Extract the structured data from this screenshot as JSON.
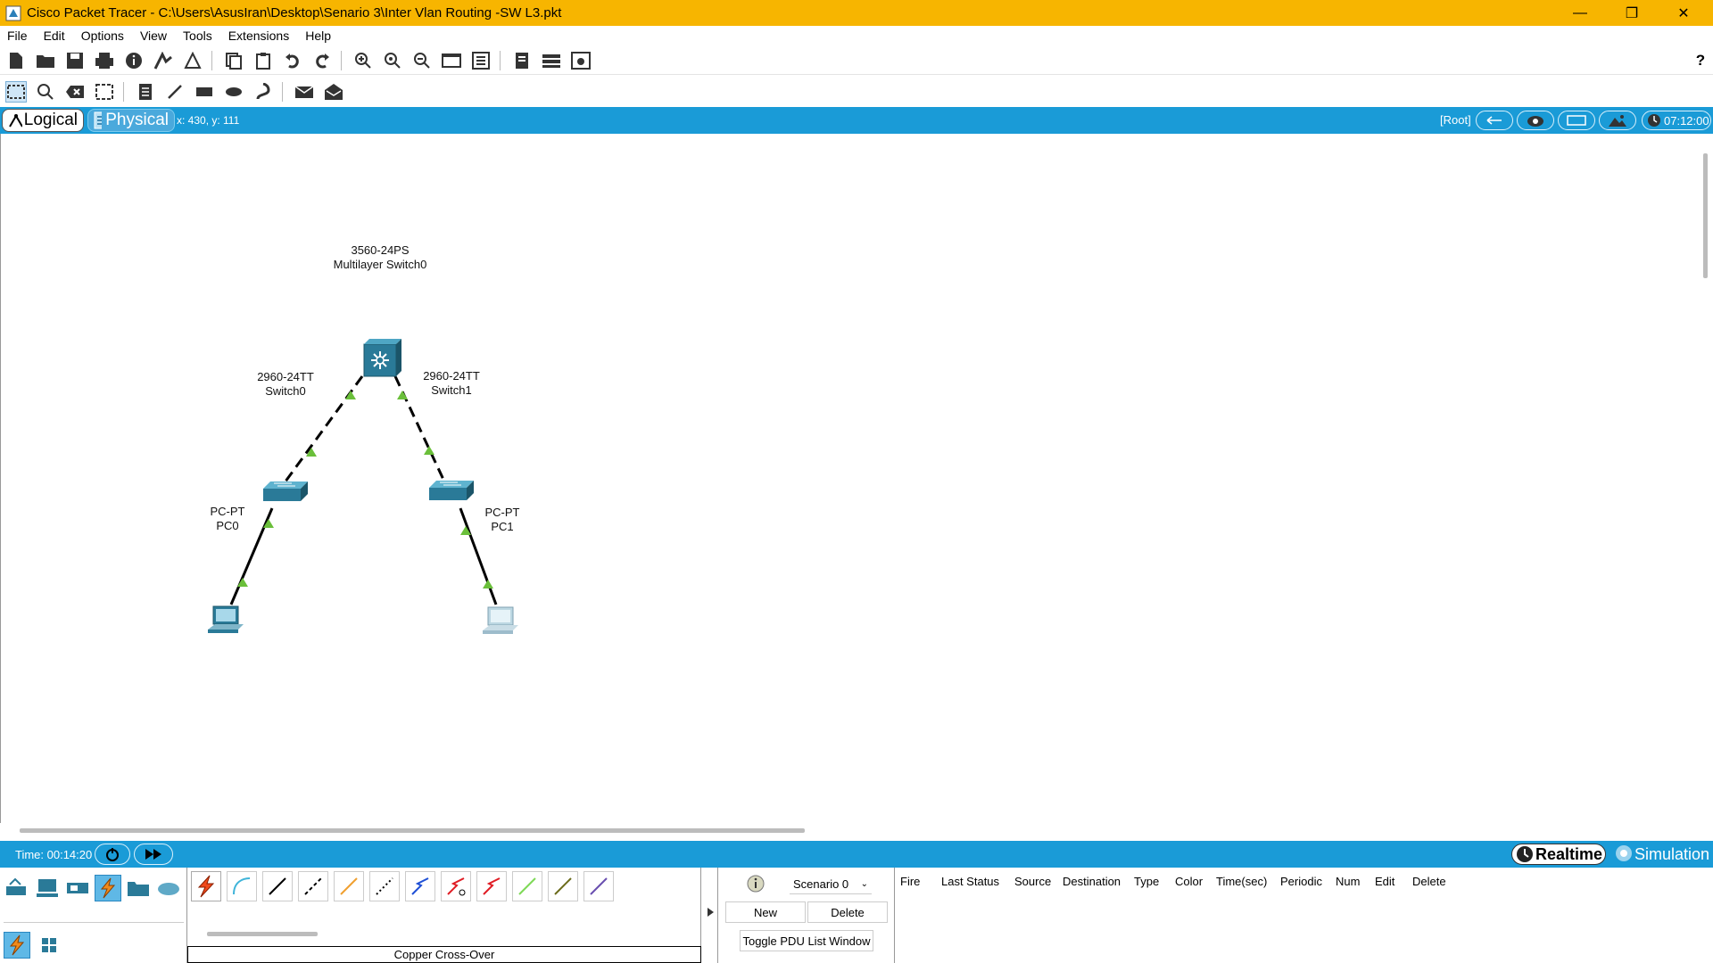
{
  "window": {
    "title": "Cisco Packet Tracer - C:\\Users\\AsusIran\\Desktop\\Senario 3\\Inter Vlan Routing -SW L3.pkt",
    "controls": [
      "minimize-icon",
      "restore-icon",
      "close-icon"
    ]
  },
  "menu": [
    "File",
    "Edit",
    "Options",
    "View",
    "Tools",
    "Extensions",
    "Help"
  ],
  "toolbar_main": [
    "new-file-icon",
    "open-folder-icon",
    "save-icon",
    "print-icon",
    "info-icon",
    "activity-wizard-icon",
    "network-info-icon",
    "copy-icon",
    "paste-icon",
    "undo-icon",
    "redo-icon",
    "zoom-in-icon",
    "zoom-reset-icon",
    "zoom-out-icon",
    "drawing-palette-icon",
    "custom-devices-icon",
    "cluster-icon",
    "view-toggle-icon",
    "screenshot-icon",
    "help-icon"
  ],
  "toolbar_edit": [
    "select-icon",
    "inspect-icon",
    "delete-icon",
    "resize-icon",
    "note-icon",
    "line-icon",
    "rectangle-icon",
    "ellipse-icon",
    "freeform-icon",
    "simple-pdu-icon",
    "complex-pdu-icon"
  ],
  "modebar": {
    "logical": "Logical",
    "physical": "Physical",
    "coords": "x: 430, y: 111",
    "root": "[Root]",
    "clock": "07:12:00"
  },
  "topology": {
    "devices": [
      {
        "id": "msw",
        "model": "3560-24PS",
        "name": "Multilayer Switch0"
      },
      {
        "id": "sw0",
        "model": "2960-24TT",
        "name": "Switch0"
      },
      {
        "id": "sw1",
        "model": "2960-24TT",
        "name": "Switch1"
      },
      {
        "id": "pc0",
        "model": "PC-PT",
        "name": "PC0"
      },
      {
        "id": "pc1",
        "model": "PC-PT",
        "name": "PC1"
      }
    ],
    "links": [
      {
        "from": "msw",
        "to": "sw0",
        "type": "dashed"
      },
      {
        "from": "msw",
        "to": "sw1",
        "type": "dashed"
      },
      {
        "from": "sw0",
        "to": "pc0",
        "type": "solid"
      },
      {
        "from": "sw1",
        "to": "pc1",
        "type": "solid"
      }
    ],
    "link_status_color": "#6abf3a"
  },
  "timebar": {
    "time": "Time: 00:14:20",
    "realtime": "Realtime",
    "simulation": "Simulation"
  },
  "connections": {
    "selected_label": "Copper Cross-Over",
    "cable_colors": [
      "#e84c1a",
      "#3fb4d9",
      "#000000",
      "#000000",
      "#f0a030",
      "#000000",
      "#1e4fd6",
      "#e01c24",
      "#e01c24",
      "#7ed957",
      "#6b6b1a",
      "#6a4fb0"
    ]
  },
  "scenario": {
    "value": "Scenario 0",
    "new": "New",
    "delete": "Delete",
    "toggle": "Toggle PDU List Window"
  },
  "pdu_list": {
    "headers": [
      "Fire",
      "Last Status",
      "Source",
      "Destination",
      "Type",
      "Color",
      "Time(sec)",
      "Periodic",
      "Num",
      "Edit",
      "Delete"
    ]
  }
}
